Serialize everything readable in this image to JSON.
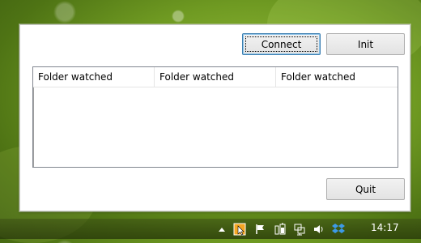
{
  "window": {
    "buttons": {
      "connect": "Connect",
      "init": "Init",
      "quit": "Quit"
    },
    "listview": {
      "columns": [
        "Folder watched",
        "Folder watched",
        "Folder watched"
      ],
      "rows": []
    }
  },
  "taskbar": {
    "clock": "14:17",
    "tray_icons": [
      "show-hidden-icons-arrow",
      "app-tray-icon",
      "action-center-flag-icon",
      "battery-icon",
      "network-icon",
      "volume-icon",
      "dropbox-icon"
    ]
  },
  "colors": {
    "accent_focus": "#3c7fb1",
    "desktop": "#6f9a22"
  }
}
